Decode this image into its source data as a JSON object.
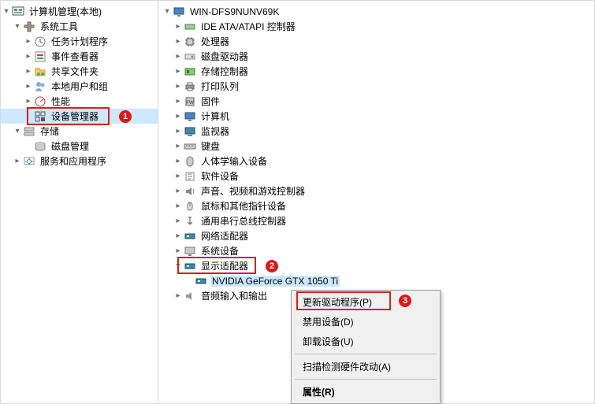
{
  "left": {
    "root": "计算机管理(本地)",
    "sys_tools": "系统工具",
    "task_scheduler": "任务计划程序",
    "event_viewer": "事件查看器",
    "shared_folders": "共享文件夹",
    "local_users": "本地用户和组",
    "performance": "性能",
    "device_manager": "设备管理器",
    "storage": "存储",
    "disk_mgmt": "磁盘管理",
    "services_apps": "服务和应用程序"
  },
  "right": {
    "computer": "WIN-DFS9NUNV69K",
    "ide": "IDE ATA/ATAPI 控制器",
    "cpu": "处理器",
    "disk_drives": "磁盘驱动器",
    "storage_ctrl": "存储控制器",
    "print_queues": "打印队列",
    "firmware": "固件",
    "computer_cat": "计算机",
    "monitors": "监视器",
    "keyboards": "键盘",
    "hid": "人体学输入设备",
    "software_dev": "软件设备",
    "sound": "声音、视频和游戏控制器",
    "mouse": "鼠标和其他指针设备",
    "usb": "通用串行总线控制器",
    "net_adapters": "网络适配器",
    "sys_devices": "系统设备",
    "display_adapters": "显示适配器",
    "gpu": "NVIDIA GeForce GTX 1050 Ti",
    "audio_io": "音频输入和输出"
  },
  "menu": {
    "update_driver": "更新驱动程序(P)",
    "disable": "禁用设备(D)",
    "uninstall": "卸载设备(U)",
    "scan": "扫描检测硬件改动(A)",
    "properties": "属性(R)"
  },
  "annot": {
    "one": "1",
    "two": "2",
    "three": "3"
  }
}
